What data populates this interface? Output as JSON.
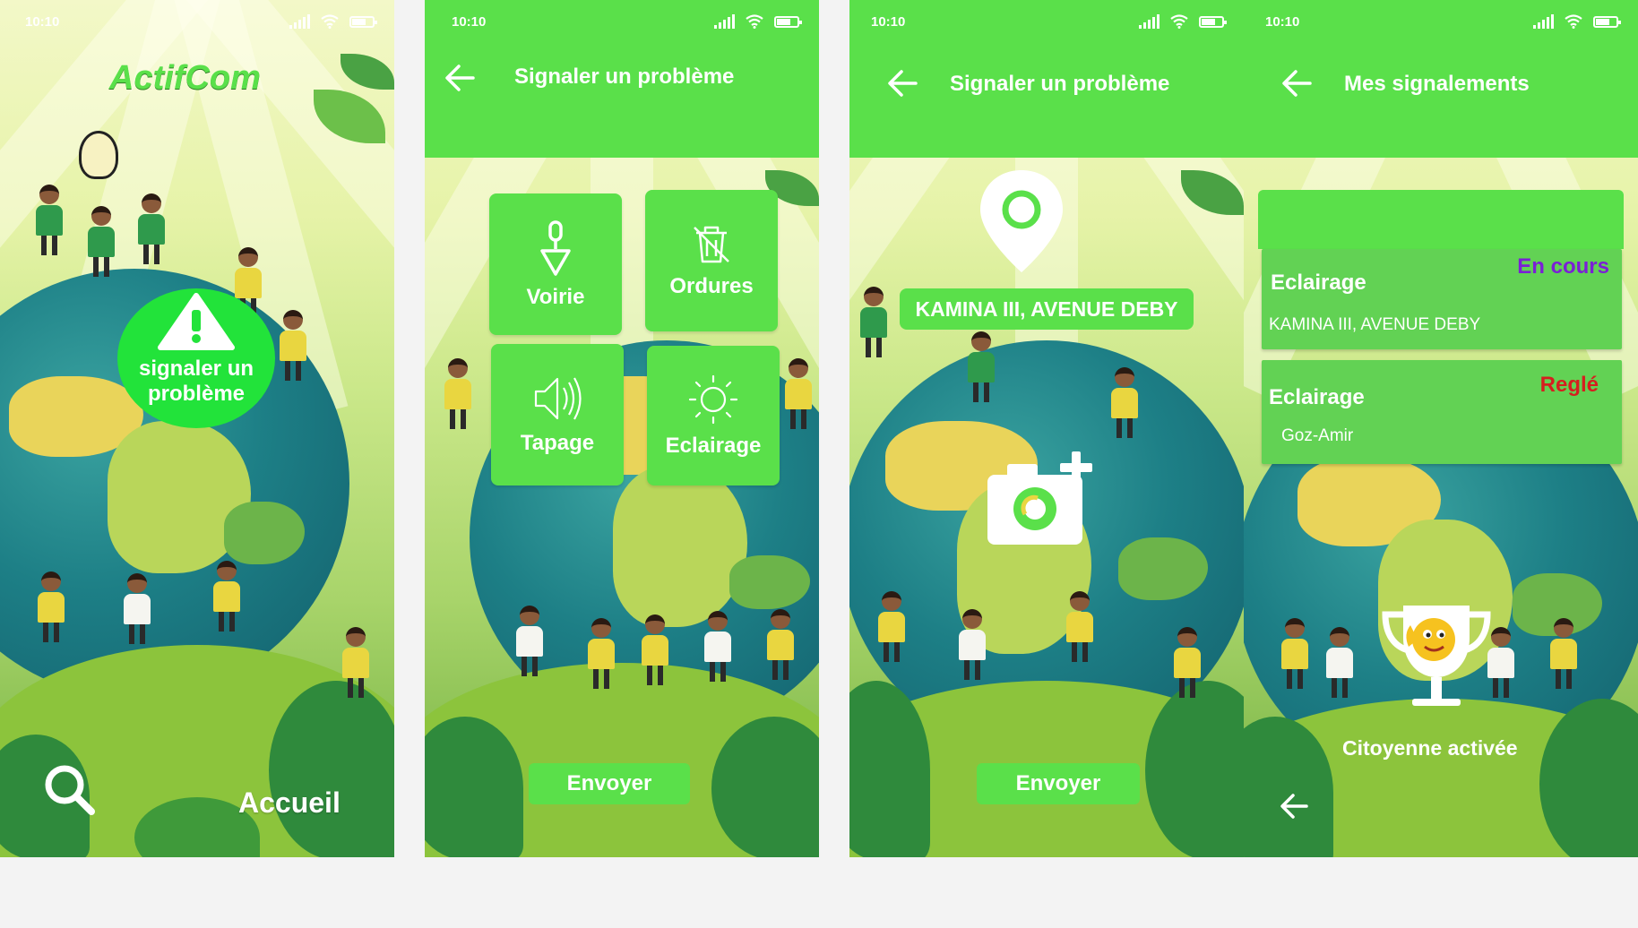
{
  "status": {
    "time": "10:10"
  },
  "home": {
    "logo": "ActifCom",
    "report_button": "signaler un problème",
    "nav_label": "Accueil",
    "icons": [
      "alert-triangle-icon",
      "search-icon"
    ]
  },
  "categories_screen": {
    "title": "Signaler un problème",
    "categories": [
      {
        "label": "Voirie",
        "icon": "road-shovel-icon"
      },
      {
        "label": "Ordures",
        "icon": "trash-crossed-icon"
      },
      {
        "label": "Tapage",
        "icon": "speaker-icon"
      },
      {
        "label": "Eclairage",
        "icon": "sun-icon"
      }
    ],
    "send_button": "Envoyer"
  },
  "location_screen": {
    "title": "Signaler un problème",
    "address": "KAMINA III, AVENUE DEBY",
    "send_button": "Envoyer",
    "icons": [
      "location-pin-icon",
      "add-photo-camera-icon"
    ]
  },
  "reports_screen": {
    "title": "Mes signalements",
    "reports": [
      {
        "category": "Eclairage",
        "status": "En cours",
        "place": "KAMINA III, AVENUE DEBY",
        "status_color": "#7b1fd6"
      },
      {
        "category": "Eclairage",
        "status": "Reglé",
        "place": "Goz-Amir",
        "status_color": "#d61f1f"
      }
    ],
    "badge": "Citoyenne activée"
  },
  "colors": {
    "primary_green": "#5ae04a",
    "alert_green": "#22e33a"
  }
}
